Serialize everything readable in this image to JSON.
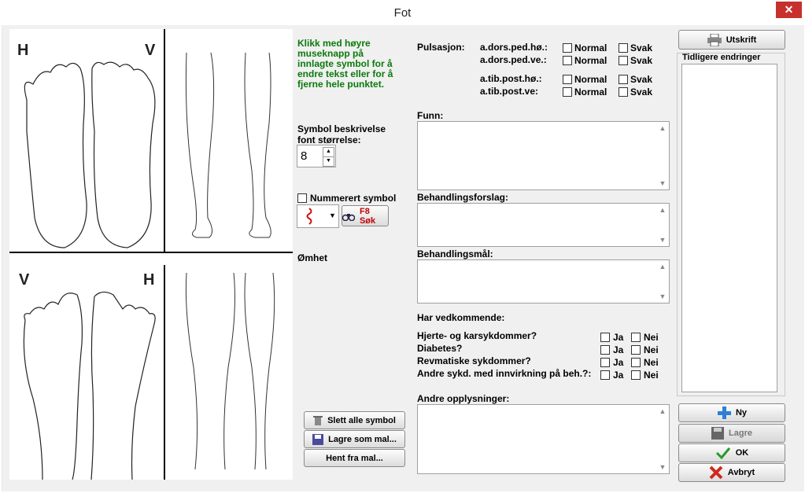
{
  "window": {
    "title": "Fot",
    "close_glyph": "✕"
  },
  "diagram": {
    "top_left_label": "H",
    "top_right_label": "V",
    "bottom_left_label": "V",
    "bottom_right_label": "H"
  },
  "instructions": "Klikk med høyre museknapp på innlagte symbol for å endre tekst eller for å fjerne hele punktet.",
  "symbol": {
    "desc_label_1": "Symbol beskrivelse",
    "desc_label_2": "font størrelse:",
    "font_size": "8",
    "numbered_label": "Nummerert symbol",
    "search_button": "F8 Søk"
  },
  "omhet_label": "Ømhet",
  "left_buttons": {
    "delete_all": "Slett alle symbol",
    "save_template": "Lagre som mal...",
    "load_template": "Hent fra mal..."
  },
  "pulse": {
    "label": "Pulsasjon:",
    "rows": [
      {
        "name": "a.dors.ped.hø.:",
        "opt1": "Normal",
        "opt2": "Svak"
      },
      {
        "name": "a.dors.ped.ve.:",
        "opt1": "Normal",
        "opt2": "Svak"
      },
      {
        "name": "a.tib.post.hø.:",
        "opt1": "Normal",
        "opt2": "Svak"
      },
      {
        "name": "a.tib.post.ve:",
        "opt1": "Normal",
        "opt2": "Svak"
      }
    ]
  },
  "fields": {
    "funn": "Funn:",
    "behandlingsforslag": "Behandlingsforslag:",
    "behandlingsmal": "Behandlingsmål:",
    "andre_opplysninger": "Andre opplysninger:"
  },
  "history": {
    "heading": "Har vedkommende:",
    "questions": [
      {
        "q": "Hjerte- og karsykdommer?",
        "yes": "Ja",
        "no": "Nei"
      },
      {
        "q": "Diabetes?",
        "yes": "Ja",
        "no": "Nei"
      },
      {
        "q": "Revmatiske sykdommer?",
        "yes": "Ja",
        "no": "Nei"
      },
      {
        "q": "Andre sykd. med innvirkning på beh.?:",
        "yes": "Ja",
        "no": "Nei"
      }
    ]
  },
  "right_panel": {
    "print_button": "Utskrift",
    "changes_label": "Tidligere endringer",
    "new_button": "Ny",
    "save_button": "Lagre",
    "ok_button": "OK",
    "cancel_button": "Avbryt"
  },
  "colors": {
    "close": "#c7302c",
    "instructions": "#0a7a0a",
    "search_text": "#c00000",
    "cancel_icon": "#d0281e",
    "ok_icon": "#2a9a2a",
    "new_icon": "#2f7fd6"
  }
}
